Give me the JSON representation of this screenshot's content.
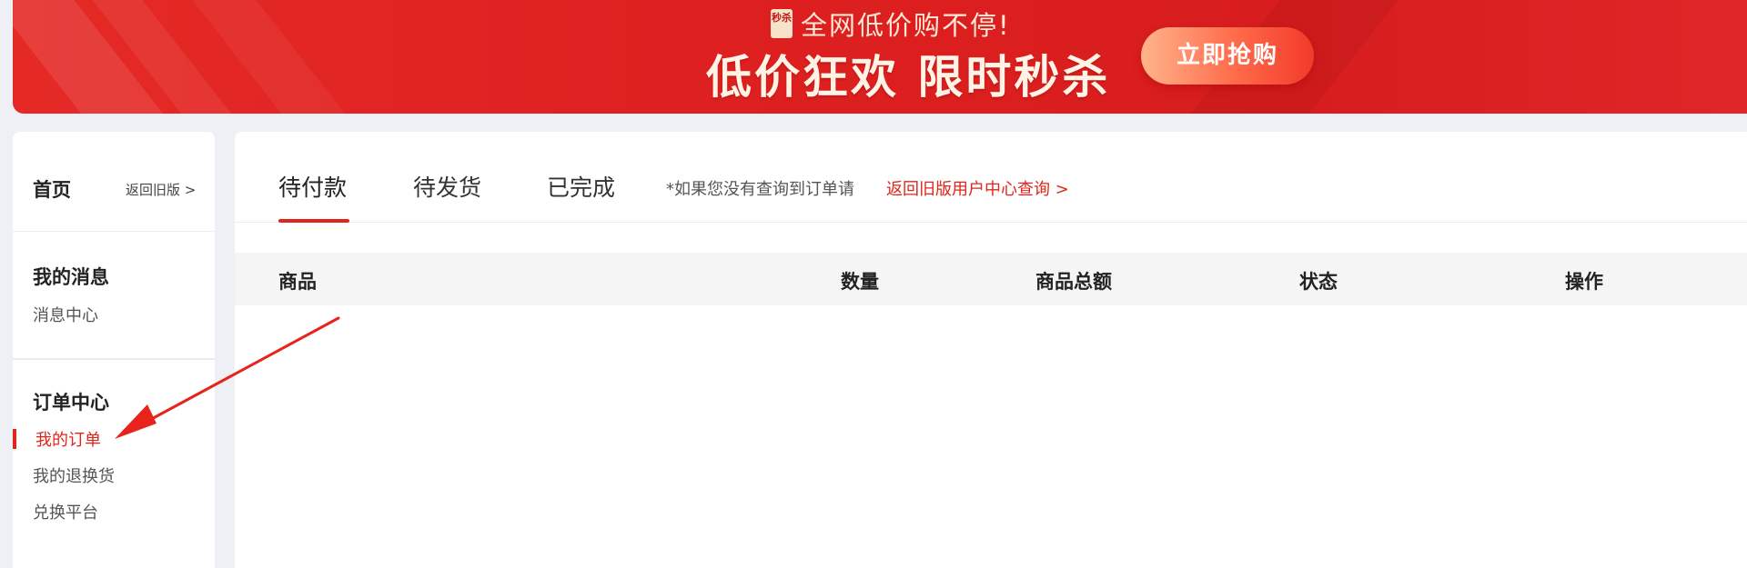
{
  "banner": {
    "icon_text": "秒杀",
    "tagline": "全网低价购不停!",
    "headline": "低价狂欢 限时秒杀",
    "cta_label": "立即抢购"
  },
  "sidebar": {
    "home_title": "首页",
    "old_version_link": "返回旧版 >",
    "sections": [
      {
        "title": "我的消息",
        "items": [
          {
            "label": "消息中心",
            "active": false
          }
        ]
      },
      {
        "title": "订单中心",
        "items": [
          {
            "label": "我的订单",
            "active": true
          },
          {
            "label": "我的退换货",
            "active": false
          },
          {
            "label": "兑换平台",
            "active": false
          }
        ]
      }
    ]
  },
  "main": {
    "tabs": [
      {
        "label": "待付款",
        "active": true
      },
      {
        "label": "待发货",
        "active": false
      },
      {
        "label": "已完成",
        "active": false
      }
    ],
    "notice": "*如果您没有查询到订单请",
    "old_query_link": "返回旧版用户中心查询 >",
    "table_headers": [
      "商品",
      "数量",
      "商品总额",
      "状态",
      "操作"
    ]
  },
  "colors": {
    "accent": "#e1251b",
    "banner_red": "#dd1f1f",
    "page_bg": "#eef0f5",
    "table_header_bg": "#f5f5f5"
  }
}
